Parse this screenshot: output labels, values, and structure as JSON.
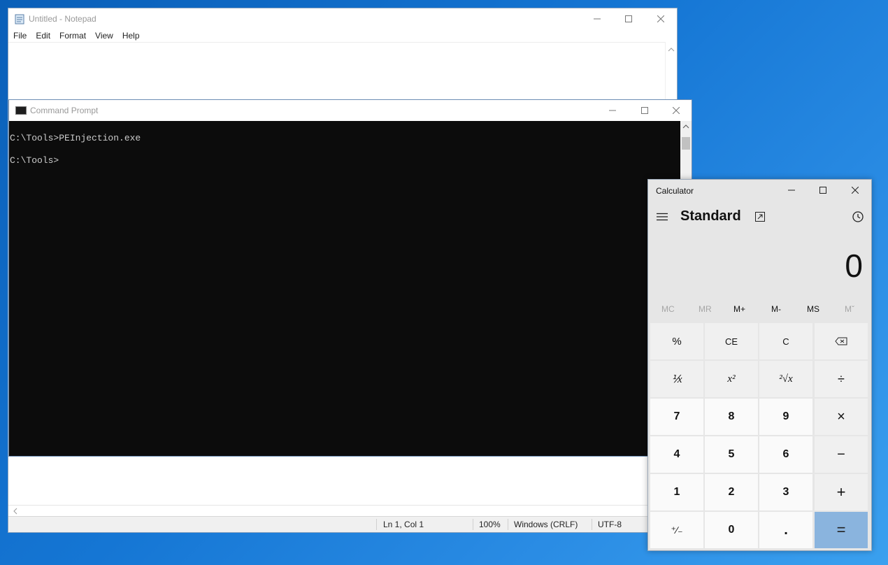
{
  "notepad": {
    "title": "Untitled - Notepad",
    "menu": [
      "File",
      "Edit",
      "Format",
      "View",
      "Help"
    ],
    "status": {
      "position": "Ln 1, Col 1",
      "zoom": "100%",
      "line_endings": "Windows (CRLF)",
      "encoding": "UTF-8"
    }
  },
  "cmd": {
    "title": "Command Prompt",
    "lines": [
      "C:\\Tools>PEInjection.exe",
      "C:\\Tools>"
    ]
  },
  "calc": {
    "title": "Calculator",
    "mode": "Standard",
    "display": "0",
    "memory": [
      "MC",
      "MR",
      "M+",
      "M-",
      "MS",
      "Mˇ"
    ],
    "memory_enabled": [
      false,
      false,
      true,
      true,
      true,
      false
    ],
    "keys": {
      "percent": "%",
      "ce": "CE",
      "c": "C",
      "reciprocal": "⅟x",
      "square": "x²",
      "sqrt": "²√x",
      "divide": "÷",
      "seven": "7",
      "eight": "8",
      "nine": "9",
      "multiply": "×",
      "four": "4",
      "five": "5",
      "six": "6",
      "minus": "−",
      "one": "1",
      "two": "2",
      "three": "3",
      "plus": "+",
      "negate": "⁺∕₋",
      "zero": "0",
      "decimal": ".",
      "equals": "="
    }
  },
  "colors": {
    "accent_equals": "#8ab4de",
    "console_bg": "#0c0c0c",
    "console_fg": "#cccccc"
  }
}
